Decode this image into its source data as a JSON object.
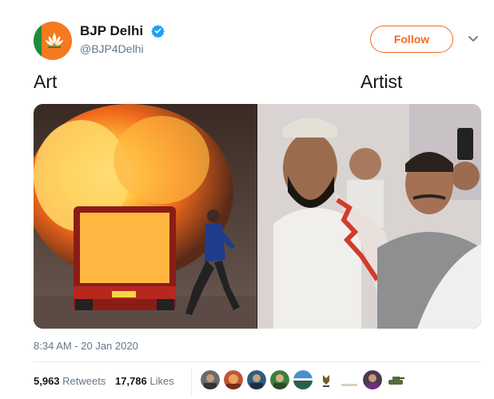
{
  "account": {
    "name": "BJP Delhi",
    "handle": "@BJP4Delhi",
    "verified_icon": "verified-badge-icon",
    "avatar_icon": "bjp-lotus-logo",
    "brand_color": "#f26b21"
  },
  "actions": {
    "follow_label": "Follow",
    "menu_icon": "chevron-down-icon"
  },
  "tweet": {
    "left_caption": "Art",
    "right_caption": "Artist",
    "timestamp": "8:34 AM - 20 Jan 2020"
  },
  "stats": {
    "retweets_count": "5,963",
    "retweets_label": "Retweets",
    "likes_count": "17,786",
    "likes_label": "Likes"
  },
  "colors": {
    "text": "#14171a",
    "secondary": "#657786",
    "divider": "#e6ecf0",
    "verified": "#1da1f2"
  }
}
